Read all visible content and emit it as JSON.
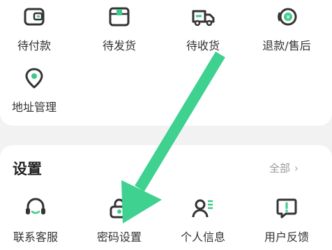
{
  "orders": {
    "items": [
      {
        "label": "待付款",
        "icon": "wallet-icon"
      },
      {
        "label": "待发货",
        "icon": "package-icon"
      },
      {
        "label": "待收货",
        "icon": "delivery-truck-icon"
      },
      {
        "label": "退款/售后",
        "icon": "refund-icon"
      },
      {
        "label": "地址管理",
        "icon": "location-pin-icon"
      }
    ]
  },
  "settings": {
    "title": "设置",
    "more_label": "全部",
    "items": [
      {
        "label": "联系客服",
        "icon": "headset-icon"
      },
      {
        "label": "密码设置",
        "icon": "lock-icon"
      },
      {
        "label": "个人信息",
        "icon": "person-info-icon"
      },
      {
        "label": "用户反馈",
        "icon": "feedback-icon"
      }
    ]
  },
  "colors": {
    "icon_dark": "#333333",
    "icon_accent": "#3ec98a",
    "annotation_arrow": "#3ed18f"
  }
}
